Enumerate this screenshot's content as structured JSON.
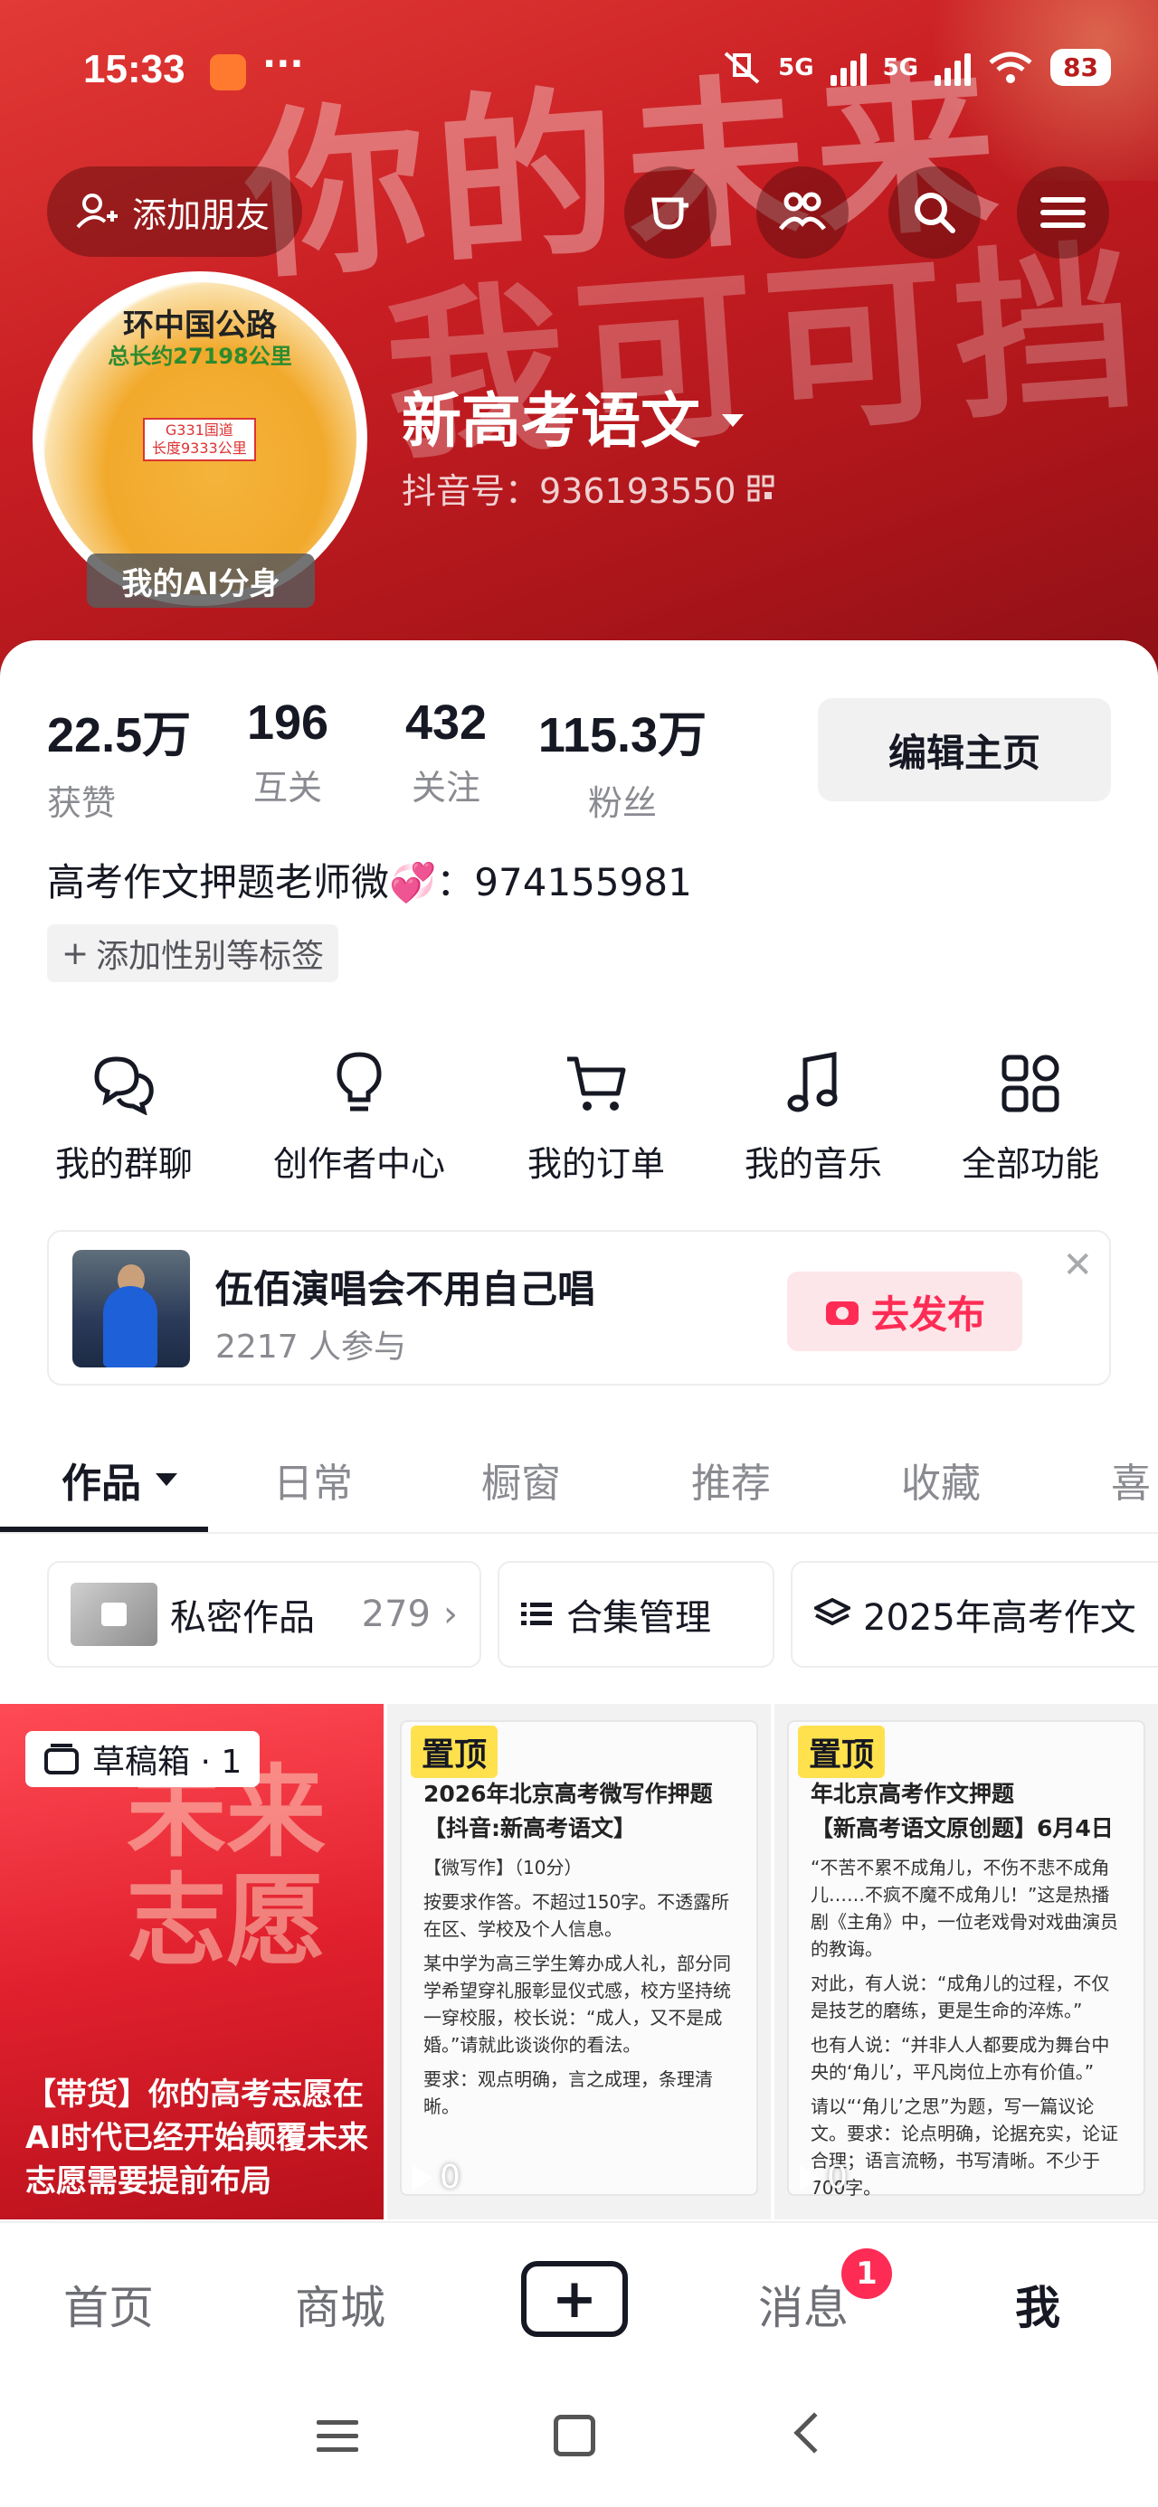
{
  "status_bar": {
    "time": "15:33",
    "dots": "···",
    "network_1": "5G",
    "network_2": "5G",
    "battery": "83"
  },
  "cover": {
    "calligraphy_line1": "你的未来",
    "calligraphy_line2": "我可可挡",
    "color": "#c81e23"
  },
  "top_actions": {
    "add_friend_label": "添加朋友",
    "icons": [
      "add-user-icon",
      "visitor-icon",
      "friends-icon",
      "search-icon",
      "menu-icon"
    ]
  },
  "avatar": {
    "map_title": "环中国公路",
    "map_subtitle": "总长约27198公里",
    "map_tag_line1": "G331国道",
    "map_tag_line2": "长度9333公里",
    "ai_badge": "我的AI分身"
  },
  "profile": {
    "nickname": "新高考语文",
    "douyin_id": "抖音号：936193550",
    "bio": "高考作文押题老师微💞：974155981",
    "tag_chip": "添加性别等标签"
  },
  "stats": [
    {
      "value": "22.5万",
      "label": "获赞"
    },
    {
      "value": "196",
      "label": "互关"
    },
    {
      "value": "432",
      "label": "关注"
    },
    {
      "value": "115.3万",
      "label": "粉丝"
    }
  ],
  "edit_button": "编辑主页",
  "quick_actions": [
    {
      "label": "我的群聊",
      "icon": "chat-icon"
    },
    {
      "label": "创作者中心",
      "icon": "bulb-icon"
    },
    {
      "label": "我的订单",
      "icon": "cart-icon"
    },
    {
      "label": "我的音乐",
      "icon": "music-icon"
    },
    {
      "label": "全部功能",
      "icon": "apps-icon"
    }
  ],
  "promo": {
    "title": "伍佰演唱会不用自己唱",
    "subtitle": "2217 人参与",
    "button": "去发布"
  },
  "tabs": [
    {
      "label": "作品"
    },
    {
      "label": "日常"
    },
    {
      "label": "橱窗"
    },
    {
      "label": "推荐"
    },
    {
      "label": "收藏"
    },
    {
      "label": "喜"
    }
  ],
  "chips": {
    "private_label": "私密作品",
    "private_count": "279",
    "collection_label": "合集管理",
    "playlist_label": "2025年高考作文"
  },
  "grid": {
    "draft_badge": "草稿箱 · 1",
    "draft_big_text": "未来志愿",
    "draft_caption": "【带货】你的高考志愿在AI时代已经开始颠覆未来志愿需要提前布局",
    "pin_label": "置顶",
    "post2": {
      "title": "2026年北京高考微写作押题",
      "subtitle": "【抖音:新高考语文】",
      "line1": "【微写作】（10分）",
      "line2": "按要求作答。不超过150字。不透露所在区、学校及个人信息。",
      "line3": "某中学为高三学生筹办成人礼，部分同学希望穿礼服彰显仪式感，校方坚持统一穿校服，校长说：“成人，又不是成婚。”请就此谈谈你的看法。",
      "line4": "要求：观点明确，言之成理，条理清晰。",
      "plays": "0"
    },
    "post3": {
      "title": "年北京高考作文押题",
      "subtitle": "【新高考语文原创题】6月4日",
      "line1": "“不苦不累不成角儿，不伤不悲不成角儿……不疯不魔不成角儿！”这是热播剧《主角》中，一位老戏骨对戏曲演员的教诲。",
      "line2": "对此，有人说：“成角儿的过程，不仅是技艺的磨练，更是生命的淬炼。”",
      "line3": "也有人说：“并非人人都要成为舞台中央的‘角儿’，平凡岗位上亦有价值。”",
      "line4": "请以“‘角儿’之思”为题，写一篇议论文。要求：论点明确，论据充实，论证合理；语言流畅，书写清晰。不少于700字。",
      "plays": "0"
    }
  },
  "bottom_nav": {
    "home": "首页",
    "mall": "商城",
    "plus": "+",
    "messages": "消息",
    "messages_badge": "1",
    "me": "我"
  }
}
